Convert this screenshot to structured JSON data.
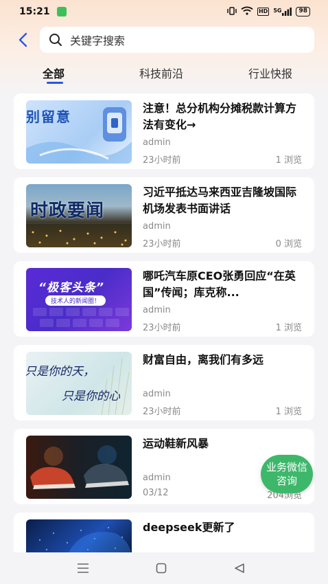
{
  "status_bar": {
    "time": "15:21",
    "network": "HD",
    "signal": "5G",
    "battery": "98"
  },
  "search": {
    "placeholder": "关键字搜索"
  },
  "tabs": [
    {
      "label": "全部",
      "active": true
    },
    {
      "label": "科技前沿",
      "active": false
    },
    {
      "label": "行业快报",
      "active": false
    }
  ],
  "articles": [
    {
      "title": "注意！总分机构分摊税款计算方法有变化→",
      "author": "admin",
      "time": "23小时前",
      "views": "1 浏览",
      "thumb_text": "别留意"
    },
    {
      "title": "习近平抵达马来西亚吉隆坡国际机场发表书面讲话",
      "author": "admin",
      "time": "23小时前",
      "views": "0 浏览",
      "thumb_text": "时政要闻"
    },
    {
      "title": "哪吒汽车原CEO张勇回应“在英国”传闻；库克称...",
      "author": "admin",
      "time": "23小时前",
      "views": "1 浏览",
      "thumb_text": "“极客头条”",
      "thumb_sub": "技术人的新闻圈！"
    },
    {
      "title": "财富自由，离我们有多远",
      "author": "admin",
      "time": "23小时前",
      "views": "1 浏览",
      "thumb_text": "只是你的天，",
      "thumb_sub": "只是你的心"
    },
    {
      "title": "运动鞋新风暴",
      "author": "admin",
      "time": "03/12",
      "views": "204浏览"
    },
    {
      "title": "deepseek更新了",
      "author": "",
      "time": "",
      "views": ""
    }
  ],
  "fab": {
    "label": "业务微信咨询"
  },
  "colors": {
    "accent": "#2b55e6",
    "fab": "#3db86b",
    "header_gradient": "#fbe3d0"
  },
  "icons": [
    "back-arrow-icon",
    "search-icon",
    "menu-icon",
    "home-icon",
    "back-icon"
  ]
}
